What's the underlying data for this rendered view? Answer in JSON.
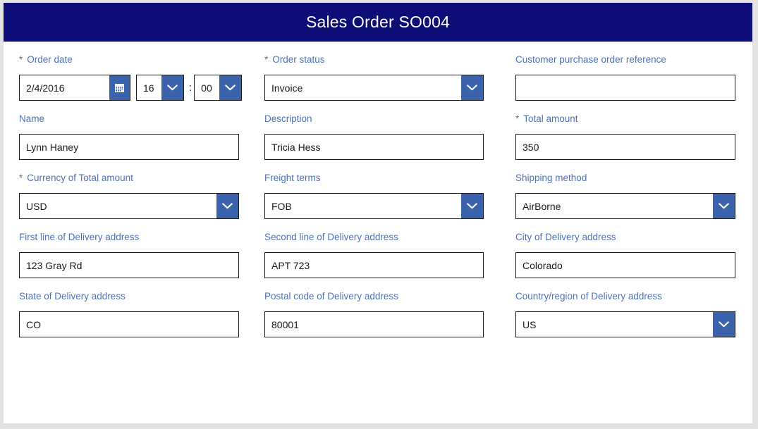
{
  "header": {
    "title": "Sales Order SO004",
    "bg_color": "#0d0d78",
    "text_color": "#ffffff"
  },
  "theme": {
    "label_color": "#5072b8",
    "dropdown_button_color": "#3a62ad",
    "field_border_color": "#1a1a1a",
    "page_background": "#ffffff"
  },
  "icons": {
    "calendar": "calendar-icon",
    "chevron_down": "chevron-down-icon"
  },
  "fields": {
    "order_date": {
      "label": "Order date",
      "required_marker": "*",
      "value": "2/4/2016",
      "placeholder": "",
      "hour": "16",
      "separator": ":",
      "minute": "00"
    },
    "order_status": {
      "label": "Order status",
      "required_marker": "*",
      "value": "Invoice"
    },
    "customer_po_reference": {
      "label": "Customer purchase order reference",
      "required_marker": "",
      "value": "",
      "placeholder": ""
    },
    "name": {
      "label": "Name",
      "required_marker": "",
      "value": "Lynn Haney"
    },
    "description": {
      "label": "Description",
      "required_marker": "",
      "value": "Tricia Hess"
    },
    "total_amount": {
      "label": "Total amount",
      "required_marker": "*",
      "value": "350"
    },
    "currency_of_total_amount": {
      "label": "Currency of Total amount",
      "required_marker": "*",
      "value": "USD"
    },
    "freight_terms": {
      "label": "Freight terms",
      "required_marker": "",
      "value": "FOB"
    },
    "shipping_method": {
      "label": "Shipping method",
      "required_marker": "",
      "value": "AirBorne"
    },
    "delivery_address_line1": {
      "label": "First line of Delivery address",
      "required_marker": "",
      "value": "123 Gray Rd"
    },
    "delivery_address_line2": {
      "label": "Second line of Delivery address",
      "required_marker": "",
      "value": "APT 723"
    },
    "delivery_city": {
      "label": "City of Delivery address",
      "required_marker": "",
      "value": "Colorado"
    },
    "delivery_state": {
      "label": "State of Delivery address",
      "required_marker": "",
      "value": "CO"
    },
    "delivery_postal_code": {
      "label": "Postal code of Delivery address",
      "required_marker": "",
      "value": "80001"
    },
    "delivery_country": {
      "label": "Country/region of Delivery address",
      "required_marker": "",
      "value": "US"
    }
  }
}
